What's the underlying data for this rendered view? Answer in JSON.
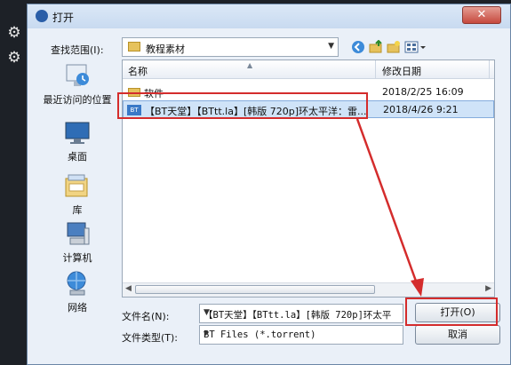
{
  "dialog": {
    "title": "打开",
    "close_label": "✕",
    "look_in_label": "查找范围(I):",
    "look_in_value": "教程素材"
  },
  "places": [
    {
      "label": "最近访问的位置",
      "icon": "recent-places-icon"
    },
    {
      "label": "桌面",
      "icon": "desktop-icon"
    },
    {
      "label": "库",
      "icon": "libraries-icon"
    },
    {
      "label": "计算机",
      "icon": "computer-icon"
    },
    {
      "label": "网络",
      "icon": "network-icon"
    }
  ],
  "columns": {
    "name": "名称",
    "date": "修改日期"
  },
  "files": [
    {
      "name": "软件",
      "date": "2018/2/25 16:09",
      "type": "folder"
    },
    {
      "name": "【BT天堂】【BTtt.la】[韩版 720p]环太平洋：雷...",
      "date": "2018/4/26 9:21",
      "type": "BT",
      "selected": true
    }
  ],
  "filename": {
    "label": "文件名(N):",
    "value": "【BT天堂】【BTtt.la】[韩版 720p]环太平"
  },
  "filetype": {
    "label": "文件类型(T):",
    "value": "BT Files (*.torrent)"
  },
  "buttons": {
    "open": "打开(O)",
    "cancel": "取消"
  }
}
